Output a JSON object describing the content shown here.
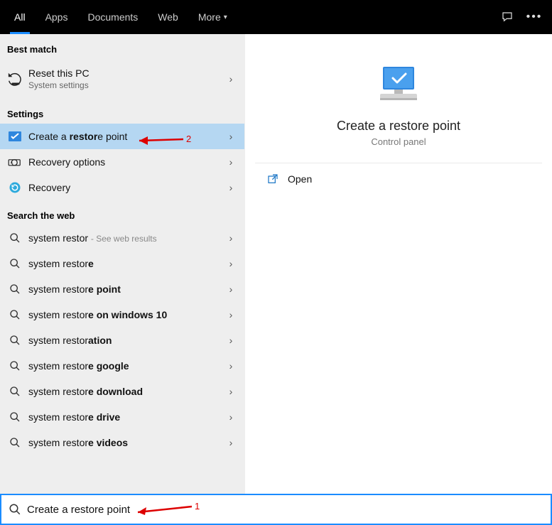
{
  "tabs": {
    "all": "All",
    "apps": "Apps",
    "documents": "Documents",
    "web": "Web",
    "more": "More"
  },
  "sections": {
    "best_match": "Best match",
    "settings": "Settings",
    "search_web": "Search the web"
  },
  "best_match": {
    "title": "Reset this PC",
    "subtitle": "System settings"
  },
  "settings_items": [
    {
      "prefix": "Create a ",
      "bold": "restor",
      "suffix": "e point"
    },
    {
      "prefix": "Recovery options",
      "bold": "",
      "suffix": ""
    },
    {
      "prefix": "Recovery",
      "bold": "",
      "suffix": ""
    }
  ],
  "web_hint": "See web results",
  "web_items": [
    {
      "prefix": "system restor",
      "bold": "",
      "suffix": "",
      "hint": true
    },
    {
      "prefix": "system restor",
      "bold": "e",
      "suffix": ""
    },
    {
      "prefix": "system restor",
      "bold": "e point",
      "suffix": ""
    },
    {
      "prefix": "system restor",
      "bold": "e on windows 10",
      "suffix": ""
    },
    {
      "prefix": "system restor",
      "bold": "ation",
      "suffix": ""
    },
    {
      "prefix": "system restor",
      "bold": "e google",
      "suffix": ""
    },
    {
      "prefix": "system restor",
      "bold": "e download",
      "suffix": ""
    },
    {
      "prefix": "system restor",
      "bold": "e drive",
      "suffix": ""
    },
    {
      "prefix": "system restor",
      "bold": "e videos",
      "suffix": ""
    }
  ],
  "preview": {
    "title": "Create a restore point",
    "subtitle": "Control panel",
    "open": "Open"
  },
  "search": {
    "value": "Create a restore point"
  },
  "annotations": {
    "one": "1",
    "two": "2"
  }
}
